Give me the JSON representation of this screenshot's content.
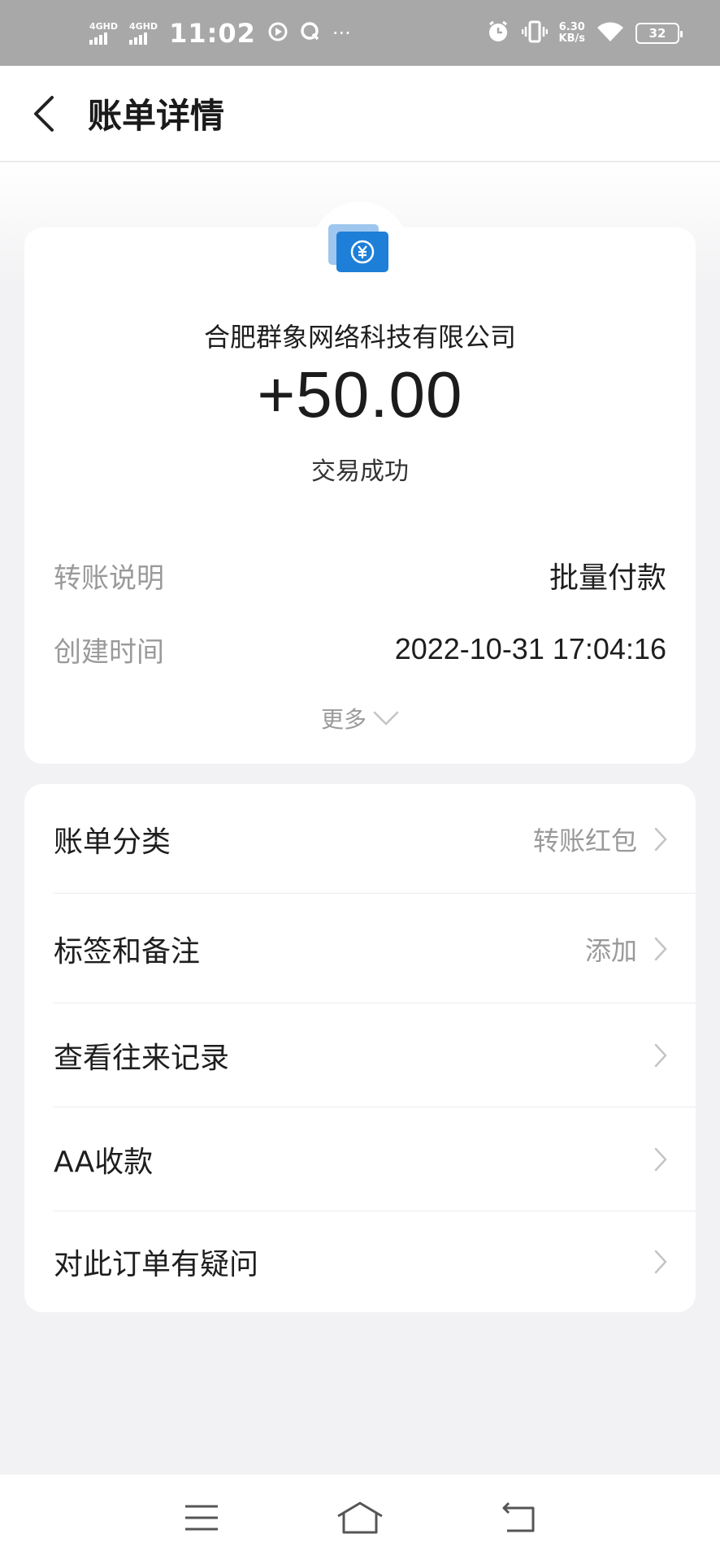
{
  "status_bar": {
    "sim1": "4GHD",
    "sim2": "4GHD",
    "time": "11:02",
    "more": "···",
    "net_speed": "6.30",
    "net_speed_unit": "KB/s",
    "battery": "32"
  },
  "header": {
    "title": "账单详情"
  },
  "bill": {
    "payee": "合肥群象网络科技有限公司",
    "amount": "+50.00",
    "status": "交易成功",
    "rows": [
      {
        "label": "转账说明",
        "value": "批量付款"
      },
      {
        "label": "创建时间",
        "value": "2022-10-31 17:04:16"
      }
    ],
    "more_label": "更多"
  },
  "actions": [
    {
      "label": "账单分类",
      "value": "转账红包"
    },
    {
      "label": "标签和备注",
      "value": "添加"
    },
    {
      "label": "查看往来记录",
      "value": ""
    },
    {
      "label": "AA收款",
      "value": ""
    },
    {
      "label": "对此订单有疑问",
      "value": ""
    }
  ],
  "colors": {
    "status_bar_bg": "#a8a8a8",
    "page_bg": "#f2f2f4",
    "logo_blue": "#1e7fd8",
    "muted_text": "#9a9a9a"
  }
}
